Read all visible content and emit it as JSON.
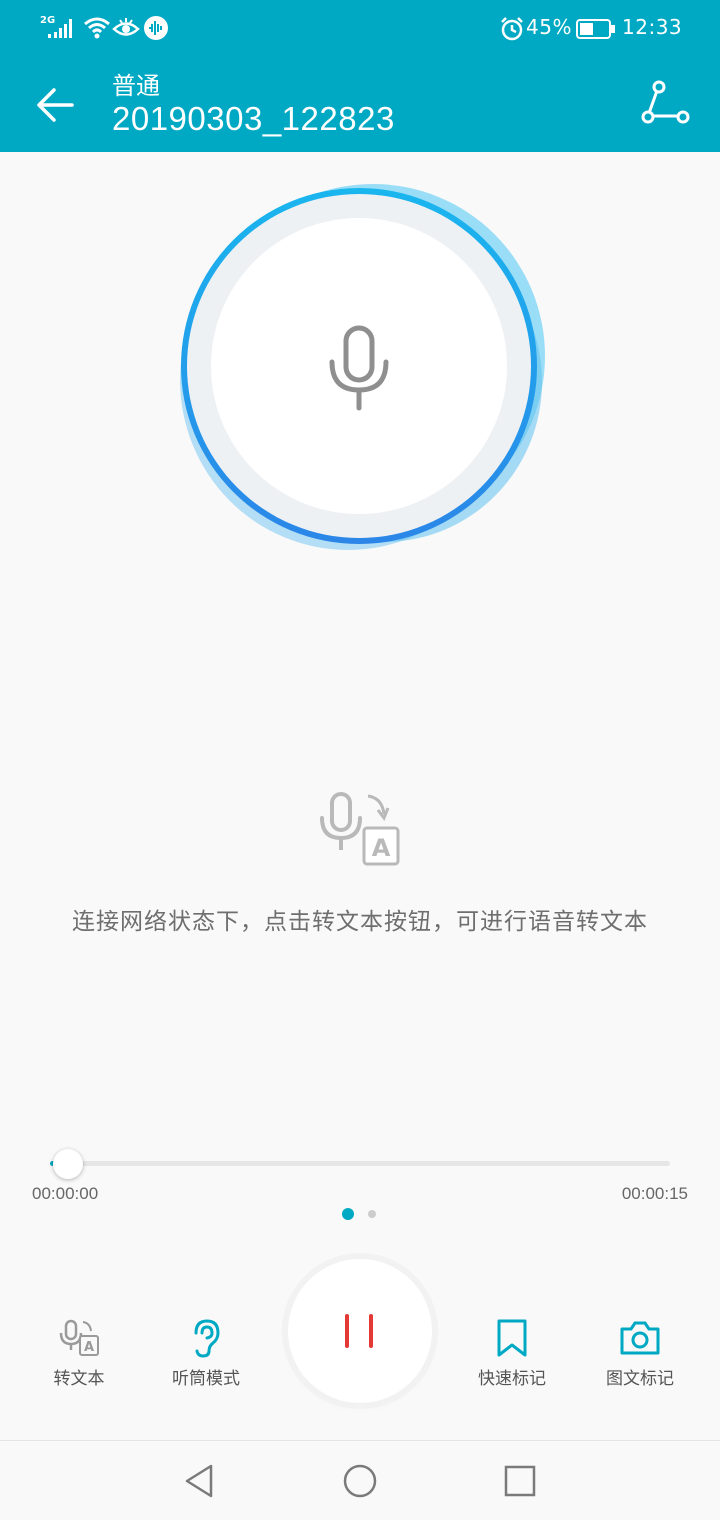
{
  "status_bar": {
    "network_label": "2G",
    "battery_percent": "45%",
    "time": "12:33"
  },
  "header": {
    "mode_label": "普通",
    "recording_name": "20190303_122823"
  },
  "main": {
    "hint_text": "连接网络状态下，点击转文本按钮，可进行语音转文本"
  },
  "playback": {
    "elapsed": "00:00:00",
    "total": "00:00:15",
    "progress_fraction": 0.0
  },
  "pager": {
    "page_count": 2,
    "current_page": 1
  },
  "toolbar": {
    "to_text_label": "转文本",
    "earpiece_label": "听筒模式",
    "quick_mark_label": "快速标记",
    "image_mark_label": "图文标记"
  },
  "colors": {
    "accent": "#00a9c3",
    "pause": "#e53935",
    "background": "#f9f9f9"
  },
  "icons": {
    "back": "arrow-left-icon",
    "share": "share-icon",
    "mic": "microphone-icon",
    "to_text": "speech-to-text-icon",
    "earpiece": "ear-icon",
    "quick_mark": "bookmark-icon",
    "image_mark": "camera-icon"
  }
}
